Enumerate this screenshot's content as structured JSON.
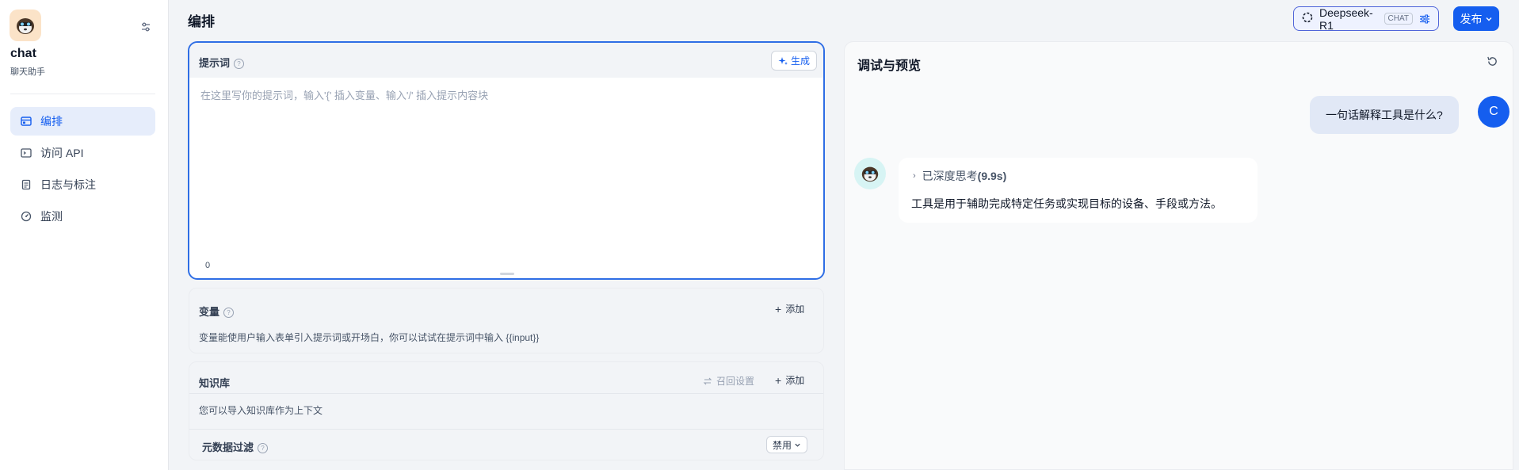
{
  "app": {
    "name": "chat",
    "description": "聊天助手"
  },
  "sidebar": {
    "items": [
      {
        "label": "编排",
        "icon": "layout-icon",
        "active": true
      },
      {
        "label": "访问 API",
        "icon": "terminal-icon",
        "active": false
      },
      {
        "label": "日志与标注",
        "icon": "document-icon",
        "active": false
      },
      {
        "label": "监测",
        "icon": "gauge-icon",
        "active": false
      }
    ]
  },
  "header": {
    "title": "编排",
    "model_name": "Deepseek-R1",
    "model_badge": "CHAT",
    "publish_label": "发布"
  },
  "prompt": {
    "label": "提示词",
    "generate_label": "生成",
    "placeholder": "在这里写你的提示词，输入'{' 插入变量、输入'/' 插入提示内容块",
    "value": "",
    "char_count": "0"
  },
  "variables": {
    "title": "变量",
    "add_label": "添加",
    "description": "变量能使用户输入表单引入提示词或开场白，你可以试试在提示词中输入 {{input}}"
  },
  "knowledge": {
    "title": "知识库",
    "recall_label": "召回设置",
    "add_label": "添加",
    "description": "您可以导入知识库作为上下文",
    "metadata_filter_label": "元数据过滤",
    "metadata_filter_value": "禁用"
  },
  "debug": {
    "title": "调试与预览",
    "user_message": "一句话解释工具是什么?",
    "user_avatar_letter": "C",
    "think_label": "已深度思考",
    "think_duration": "(9.9s)",
    "answer": "工具是用于辅助完成特定任务或实现目标的设备、手段或方法。"
  },
  "colors": {
    "accent": "#155eef",
    "active_nav_bg": "#e6edfb",
    "user_bubble": "#e1e8f6"
  }
}
